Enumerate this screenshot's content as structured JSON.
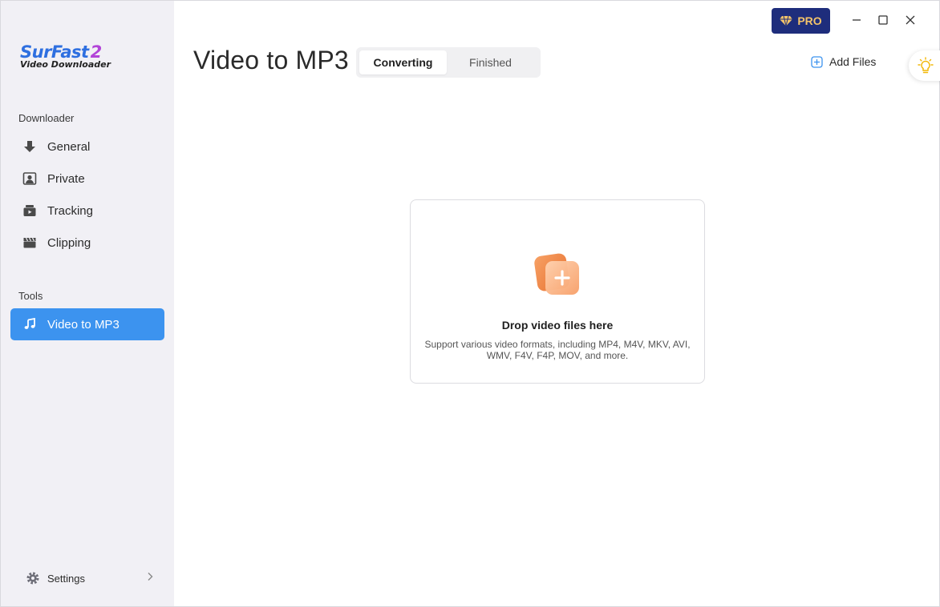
{
  "logo": {
    "name": "SurFast",
    "version": "2",
    "subtitle": "Video Downloader"
  },
  "sidebar": {
    "downloader_label": "Downloader",
    "items": [
      {
        "label": "General",
        "icon": "download-arrow-icon"
      },
      {
        "label": "Private",
        "icon": "private-user-icon"
      },
      {
        "label": "Tracking",
        "icon": "tracking-video-icon"
      },
      {
        "label": "Clipping",
        "icon": "clapperboard-icon"
      }
    ],
    "tools_label": "Tools",
    "tools": [
      {
        "label": "Video to MP3",
        "icon": "music-note-icon",
        "active": true
      }
    ],
    "settings_label": "Settings"
  },
  "header": {
    "title": "Video to MP3",
    "tabs": [
      {
        "label": "Converting",
        "active": true
      },
      {
        "label": "Finished",
        "active": false
      }
    ],
    "add_files_label": "Add Files",
    "pro_label": "PRO"
  },
  "dropzone": {
    "title": "Drop video files here",
    "description": "Support various video formats, including MP4, M4V, MKV, AVI, WMV, F4V, F4P, MOV, and more."
  },
  "colors": {
    "accent": "#3c93ef",
    "pro_bg": "#1e2d7c",
    "pro_text": "#f4c46a",
    "sidebar_bg": "#f1f0f5",
    "dropzone_icon": "#f39a5a"
  }
}
